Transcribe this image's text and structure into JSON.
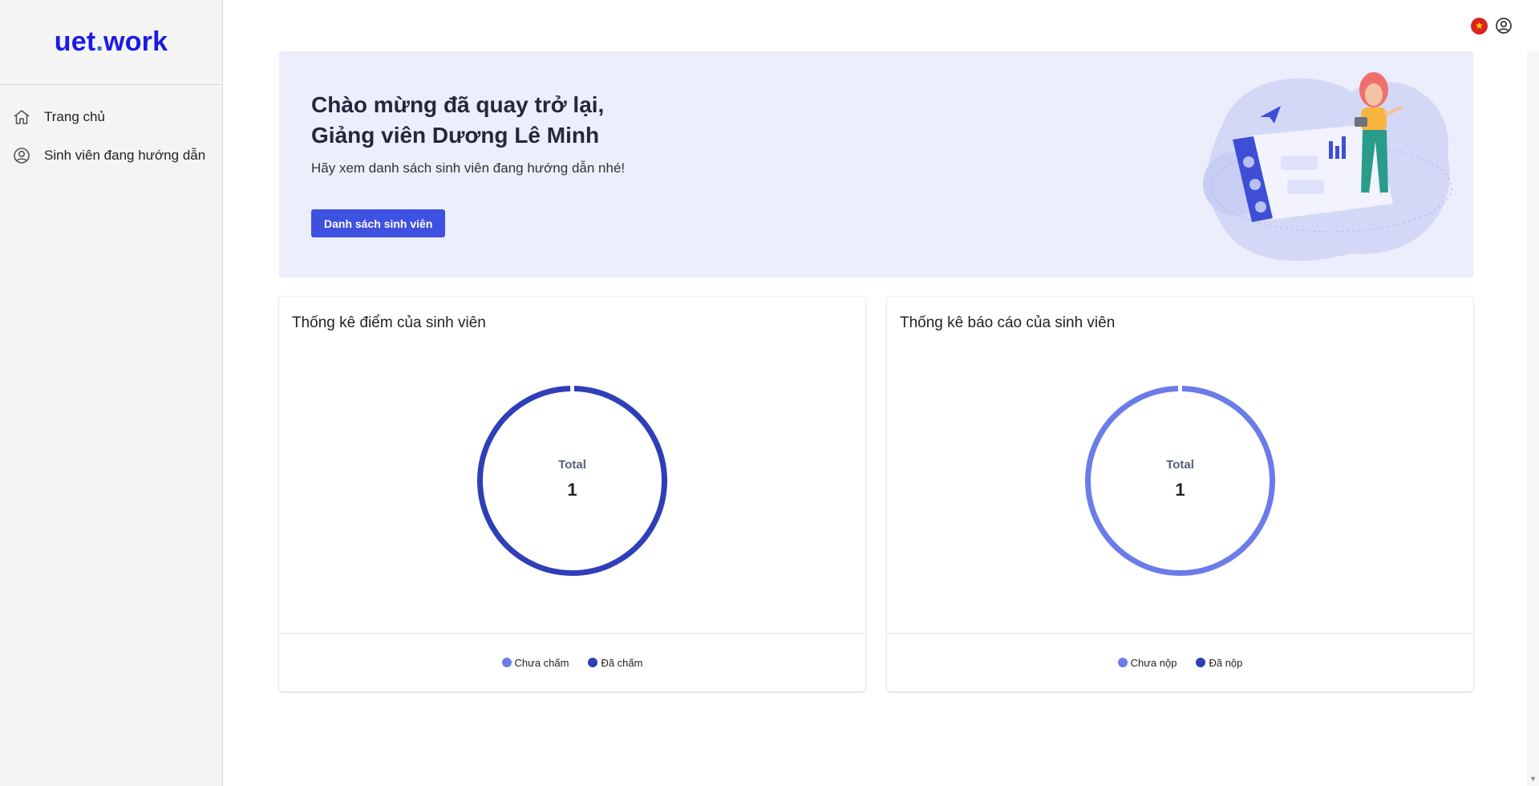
{
  "brand": {
    "part1": "uet",
    "dot": ".",
    "part2": "work"
  },
  "sidebar": {
    "items": [
      {
        "label": "Trang chủ",
        "icon": "home-icon"
      },
      {
        "label": "Sinh viên đang hướng dẫn",
        "icon": "user-circle-icon"
      }
    ]
  },
  "topbar": {
    "language_icon": "vietnam-flag-icon",
    "user_icon": "user-circle-icon"
  },
  "hero": {
    "title_line1": "Chào mừng đã quay trở lại,",
    "title_line2": "Giảng viên Dương Lê Minh",
    "subtitle": "Hãy xem danh sách sinh viên đang hướng dẫn nhé!",
    "button_label": "Danh sách sinh viên"
  },
  "colors": {
    "accent": "#3f51e0",
    "dark_series": "#2f3fb8",
    "light_series": "#6b7ce8",
    "hero_bg": "#eceefb"
  },
  "chart_data": [
    {
      "type": "pie",
      "title": "Thống kê điểm của sinh viên",
      "center_label": "Total",
      "center_value": "1",
      "series": [
        {
          "name": "Chưa chấm",
          "value": 0,
          "color": "#6b7ce8"
        },
        {
          "name": "Đã chấm",
          "value": 1,
          "color": "#2f3fb8"
        }
      ]
    },
    {
      "type": "pie",
      "title": "Thống kê báo cáo của sinh viên",
      "center_label": "Total",
      "center_value": "1",
      "series": [
        {
          "name": "Chưa nộp",
          "value": 1,
          "color": "#6b7ce8"
        },
        {
          "name": "Đã nộp",
          "value": 0,
          "color": "#2f3fb8"
        }
      ]
    }
  ]
}
